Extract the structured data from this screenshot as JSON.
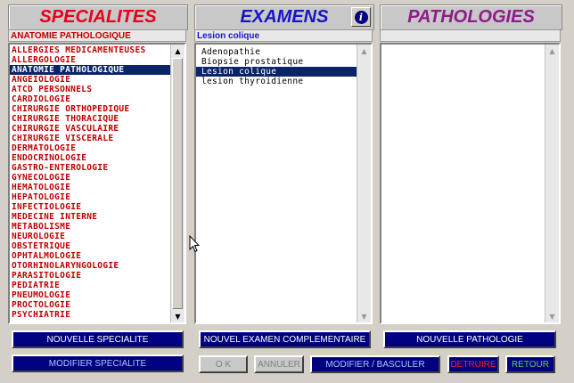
{
  "colors": {
    "specialites": "#e8001a",
    "examens": "#1616c8",
    "pathologies": "#8e1c8a",
    "navy": "#000080",
    "detruire": "#ff2020",
    "retour": "#60d060"
  },
  "specialites": {
    "title": "SPECIALITES",
    "selected_value": "ANATOMIE PATHOLOGIQUE",
    "items": [
      "ALLERGIES MEDICAMENTEUSES",
      "ALLERGOLOGIE",
      "ANATOMIE PATHOLOGIQUE",
      "ANGEIOLOGIE",
      "ATCD PERSONNELS",
      "CARDIOLOGIE",
      "CHIRURGIE ORTHOPEDIQUE",
      "CHIRURGIE THORACIQUE",
      "CHIRURGIE VASCULAIRE",
      "CHIRURGIE VISCERALE",
      "DERMATOLOGIE",
      "ENDOCRINOLOGIE",
      "GASTRO-ENTEROLOGIE",
      "GYNECOLOGIE",
      "HEMATOLOGIE",
      "HEPATOLOGIE",
      "INFECTIOLOGIE",
      "MEDECINE INTERNE",
      "METABOLISME",
      "NEUROLOGIE",
      "OBSTETRIQUE",
      "OPHTALMOLOGIE",
      "OTORHINOLARYNGOLOGIE",
      "PARASITOLOGIE",
      "PEDIATRIE",
      "PNEUMOLOGIE",
      "PROCTOLOGIE",
      "PSYCHIATRIE"
    ],
    "selected_index": 2,
    "btn_new": "NOUVELLE SPECIALITE",
    "btn_modify": "MODIFIER SPECIALITE"
  },
  "examens": {
    "title": "EXAMENS",
    "selected_value": "Lesion colique",
    "items": [
      "Adenopathie",
      "Biopsie prostatique",
      "Lesion colique",
      "lesion thyroidienne"
    ],
    "selected_index": 2,
    "btn_new": "NOUVEL EXAMEN COMPLEMENTAIRE",
    "info_icon": "i"
  },
  "pathologies": {
    "title": "PATHOLOGIES",
    "selected_value": "",
    "items": [],
    "btn_new": "NOUVELLE PATHOLOGIE"
  },
  "actions": {
    "ok": "O K",
    "annuler": "ANNULER",
    "modifier_basculer": "MODIFIER / BASCULER",
    "detruire": "DETRUIRE",
    "retour": "RETOUR"
  }
}
